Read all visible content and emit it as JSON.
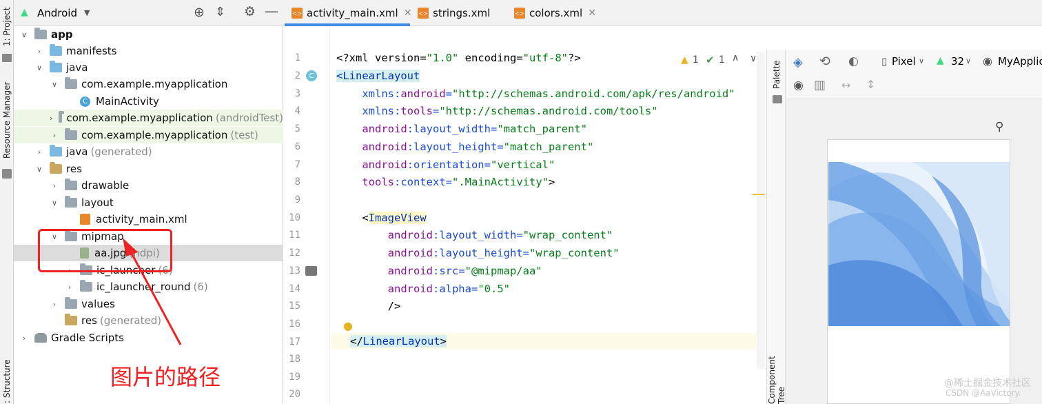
{
  "left_strip": {
    "project_tab": "1: Project",
    "resource_tab": "Resource Manager",
    "structure_tab": ": Structure"
  },
  "project_panel": {
    "view_label": "Android",
    "tree": [
      {
        "label": "app",
        "bold": true
      },
      {
        "label": "manifests"
      },
      {
        "label": "java"
      },
      {
        "label": "com.example.myapplication"
      },
      {
        "label": "MainActivity"
      },
      {
        "label": "com.example.myapplication",
        "suffix": "(androidTest)"
      },
      {
        "label": "com.example.myapplication",
        "suffix": "(test)"
      },
      {
        "label": "java",
        "suffix": "(generated)"
      },
      {
        "label": "res"
      },
      {
        "label": "drawable"
      },
      {
        "label": "layout"
      },
      {
        "label": "activity_main.xml"
      },
      {
        "label": "mipmap"
      },
      {
        "label": "aa.jpg",
        "suffix": "(hdpi)"
      },
      {
        "label": "ic_launcher",
        "suffix": "(6)"
      },
      {
        "label": "ic_launcher_round",
        "suffix": "(6)"
      },
      {
        "label": "values"
      },
      {
        "label": "res",
        "suffix": "(generated)"
      },
      {
        "label": "Gradle Scripts"
      }
    ]
  },
  "annotation": {
    "text": "图片的路径",
    "color": "#ee2222"
  },
  "editor_tabs": [
    {
      "label": "activity_main.xml",
      "active": true
    },
    {
      "label": "strings.xml"
    },
    {
      "label": "colors.xml"
    }
  ],
  "editor": {
    "line_numbers": [
      "1",
      "2",
      "3",
      "4",
      "5",
      "6",
      "7",
      "8",
      "9",
      "10",
      "11",
      "12",
      "13",
      "14",
      "15",
      "16",
      "17",
      "18",
      "19",
      "20"
    ],
    "inspections": {
      "warnings": "1",
      "ok": "1"
    },
    "code": {
      "l1a": "<?xml version=",
      "l1b": "\"1.0\"",
      "l1c": " encoding=",
      "l1d": "\"utf-8\"",
      "l1e": "?>",
      "l2": "<LinearLayout",
      "l3a": "    xmlns:",
      "l3b": "android",
      "l3c": "=",
      "l3d": "\"http://schemas.android.com/apk/res/android\"",
      "l4a": "    xmlns:",
      "l4b": "tools",
      "l4c": "=",
      "l4d": "\"http://schemas.android.com/tools\"",
      "l5a": "    android",
      "l5b": ":layout_width",
      "l5c": "=",
      "l5d": "\"match_parent\"",
      "l6a": "    android",
      "l6b": ":layout_height",
      "l6c": "=",
      "l6d": "\"match_parent\"",
      "l7a": "    android",
      "l7b": ":orientation",
      "l7c": "=",
      "l7d": "\"vertical\"",
      "l8a": "    tools",
      "l8b": ":context",
      "l8c": "=",
      "l8d": "\".MainActivity\"",
      "l8e": ">",
      "l10a": "    <",
      "l10b": "ImageView",
      "l11a": "        android",
      "l11b": ":layout_width",
      "l11c": "=",
      "l11d": "\"wrap_content\"",
      "l12a": "        android",
      "l12b": ":layout_height",
      "l12c": "=",
      "l12d": "\"wrap_content\"",
      "l13a": "        android",
      "l13b": ":src",
      "l13c": "=",
      "l13d": "\"@mipmap/aa\"",
      "l14a": "        android",
      "l14b": ":alpha",
      "l14c": "=",
      "l14d": "\"0.5\"",
      "l15": "        />",
      "l17a": "</",
      "l17b": "LinearLayout",
      "l17c": ">"
    }
  },
  "design": {
    "palette_label": "Palette",
    "component_tree_label": "Component Tree",
    "device": "Pixel",
    "api": "32",
    "app": "MyApplic"
  },
  "watermark": {
    "line1": "@稀土掘金技术社区",
    "line2": "CSDN @AaVictory."
  }
}
